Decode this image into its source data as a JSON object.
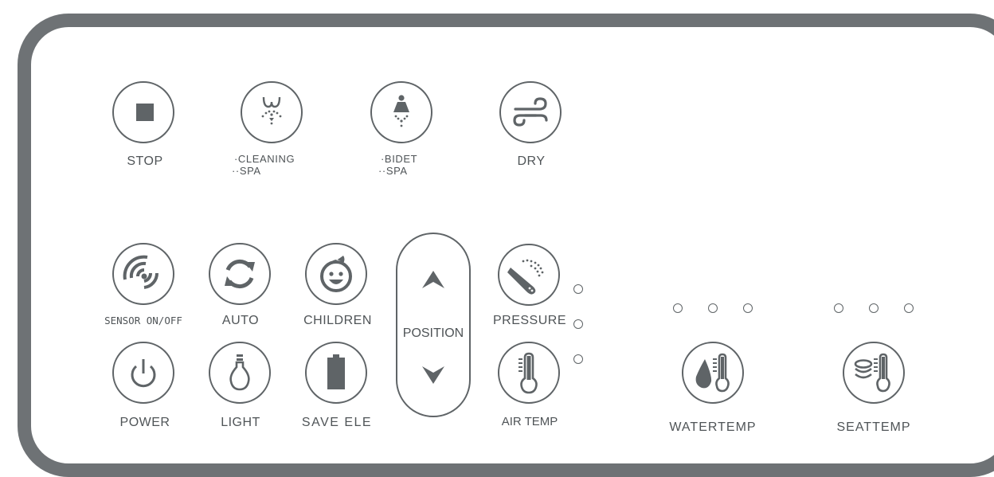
{
  "buttons": {
    "stop": "STOP",
    "cleaning": {
      "line1": "·CLEANING",
      "line2": "··SPA"
    },
    "bidet": {
      "line1": "·BIDET",
      "line2": "··SPA"
    },
    "dry": "DRY",
    "sensor": "SENSOR ON/OFF",
    "auto": "AUTO",
    "children": "CHILDREN",
    "position": "POSITION",
    "pressure": "PRESSURE",
    "power": "POWER",
    "light": "LIGHT",
    "save_ele": "SAVE ELE",
    "air_temp": "AIR TEMP",
    "water_temp": "WATERTEMP",
    "seat_temp": "SEATTEMP"
  },
  "icons": {
    "stop": "stop-square-icon",
    "cleaning": "rear-spray-icon",
    "bidet": "bidet-spray-icon",
    "dry": "wind-icon",
    "sensor": "signal-icon",
    "auto": "refresh-icon",
    "children": "child-face-icon",
    "position_up": "chevron-up-icon",
    "position_down": "chevron-down-icon",
    "pressure": "nozzle-spray-icon",
    "power": "power-icon",
    "light": "light-bulb-icon",
    "save_ele": "battery-icon",
    "air_temp": "thermometer-icon",
    "water_temp": "water-drop-thermometer-icon",
    "seat_temp": "seat-heat-thermometer-icon"
  },
  "indicators": {
    "pressure_levels": 3,
    "water_temp_levels": 3,
    "seat_temp_levels": 3
  },
  "colors": {
    "frame": "#6e7275",
    "stroke": "#5f6467",
    "text": "#4f5457"
  }
}
